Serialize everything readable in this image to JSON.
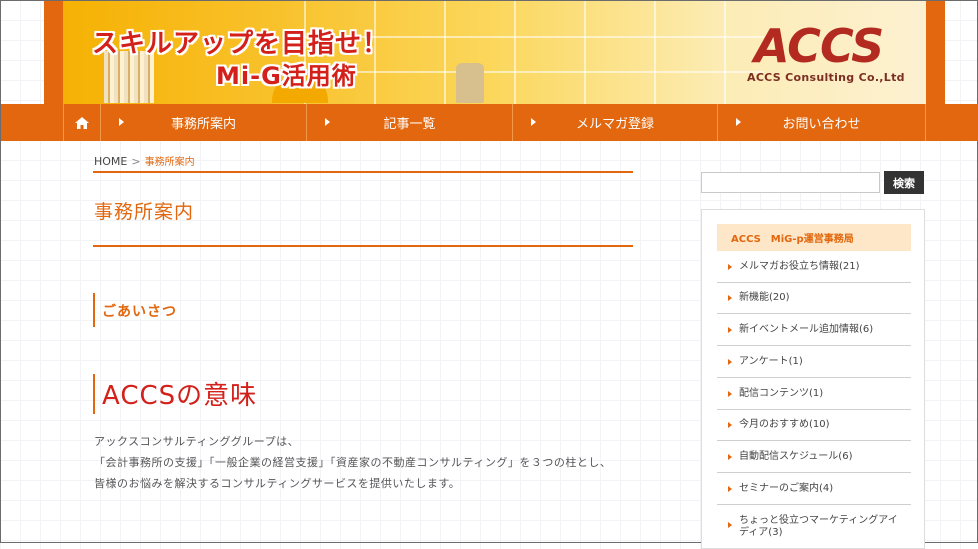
{
  "header": {
    "banner_line1": "スキルアップを目指せ！",
    "banner_line2": "Mi-G活用術",
    "logo_main": "ACCS",
    "logo_sub": "ACCS Consulting Co.,Ltd"
  },
  "nav": {
    "home_icon": "home-icon",
    "items": [
      {
        "label": "事務所案内"
      },
      {
        "label": "記事一覧"
      },
      {
        "label": "メルマガ登録"
      },
      {
        "label": "お問い合わせ"
      }
    ]
  },
  "breadcrumb": {
    "home": "HOME",
    "separator": ">",
    "current": "事務所案内"
  },
  "main": {
    "page_title": "事務所案内",
    "section_heading": "ごあいさつ",
    "subheading": "ACCSの意味",
    "paragraph_lines": [
      "アックスコンサルティンググループは、",
      "「会計事務所の支援」「一般企業の経営支援」「資産家の不動産コンサルティング」を３つの柱とし、",
      "皆様のお悩みを解決するコンサルティングサービスを提供いたします。"
    ]
  },
  "sidebar": {
    "search_placeholder": "",
    "search_button": "検索",
    "box_title": "ACCS　MiG-p運営事務局",
    "categories": [
      {
        "label": "メルマガお役立ち情報(21)"
      },
      {
        "label": "新機能(20)"
      },
      {
        "label": "新イベントメール追加情報(6)"
      },
      {
        "label": "アンケート(1)"
      },
      {
        "label": "配信コンテンツ(1)"
      },
      {
        "label": "今月のおすすめ(10)"
      },
      {
        "label": "自動配信スケジュール(6)"
      },
      {
        "label": "セミナーのご案内(4)"
      },
      {
        "label": "ちょっと役立つマーケティングアイディア(3)"
      }
    ]
  },
  "colors": {
    "accent": "#e2670e",
    "heading_red": "#d3201a",
    "sidebar_head_bg": "#fde7c8"
  }
}
